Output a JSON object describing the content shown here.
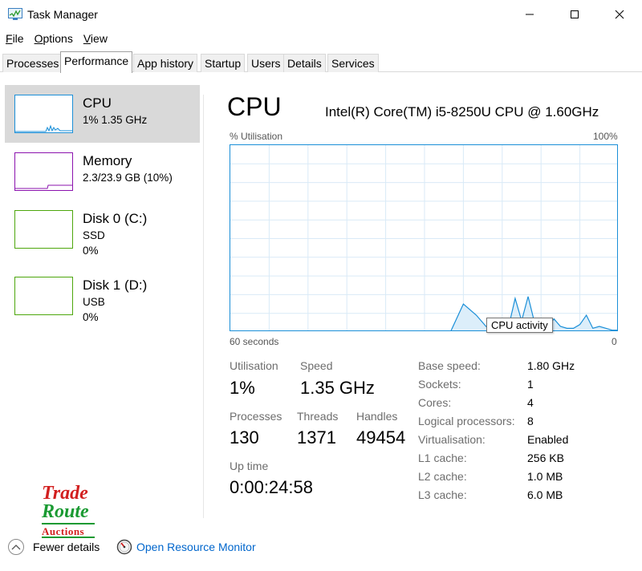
{
  "window": {
    "title": "Task Manager",
    "icon": "task-manager-icon",
    "controls": [
      "minimize-icon",
      "maximize-icon",
      "close-icon"
    ]
  },
  "menu": [
    {
      "label": "File",
      "accel": "F",
      "rest": "ile"
    },
    {
      "label": "Options",
      "accel": "O",
      "rest": "ptions"
    },
    {
      "label": "View",
      "accel": "V",
      "rest": "iew"
    }
  ],
  "tabs": [
    {
      "label": "Processes",
      "active": false
    },
    {
      "label": "Performance",
      "active": true
    },
    {
      "label": "App history",
      "active": false
    },
    {
      "label": "Startup",
      "active": false
    },
    {
      "label": "Users",
      "active": false
    },
    {
      "label": "Details",
      "active": false
    },
    {
      "label": "Services",
      "active": false
    }
  ],
  "resources": [
    {
      "name": "CPU",
      "line1": "1% 1.35 GHz",
      "line2": "",
      "color": "#1a8fd8",
      "selected": true
    },
    {
      "name": "Memory",
      "line1": "2.3/23.9 GB (10%)",
      "line2": "",
      "color": "#8b12ae",
      "selected": false
    },
    {
      "name": "Disk 0 (C:)",
      "line1": "SSD",
      "line2": "0%",
      "color": "#4da60c",
      "selected": false
    },
    {
      "name": "Disk 1 (D:)",
      "line1": "USB",
      "line2": "0%",
      "color": "#4da60c",
      "selected": false
    }
  ],
  "detail": {
    "title": "CPU",
    "model": "Intel(R) Core(TM) i5-8250U CPU @ 1.60GHz",
    "graph": {
      "y_label": "% Utilisation",
      "y_max_label": "100%",
      "x_left_label": "60 seconds",
      "x_right_label": "0",
      "tooltip": "CPU activity",
      "line_color": "#1a8fd8",
      "fill_color": "#dceefa",
      "grid_color": "#d9eaf7"
    },
    "stats": {
      "utilisation_label": "Utilisation",
      "utilisation": "1%",
      "speed_label": "Speed",
      "speed": "1.35 GHz",
      "processes_label": "Processes",
      "processes": "130",
      "threads_label": "Threads",
      "threads": "1371",
      "handles_label": "Handles",
      "handles": "49454",
      "uptime_label": "Up time",
      "uptime": "0:00:24:58"
    },
    "specs": [
      {
        "label": "Base speed:",
        "value": "1.80 GHz"
      },
      {
        "label": "Sockets:",
        "value": "1"
      },
      {
        "label": "Cores:",
        "value": "4"
      },
      {
        "label": "Logical processors:",
        "value": "8"
      },
      {
        "label": "Virtualisation:",
        "value": "Enabled"
      },
      {
        "label": "L1 cache:",
        "value": "256 KB"
      },
      {
        "label": "L2 cache:",
        "value": "1.0 MB"
      },
      {
        "label": "L3 cache:",
        "value": "6.0 MB"
      }
    ]
  },
  "chart_data": {
    "type": "area",
    "x": [
      60,
      58,
      56,
      54,
      52,
      50,
      48,
      46,
      44,
      42,
      40,
      38,
      36,
      34,
      32,
      30,
      28,
      26,
      24,
      22,
      20,
      18,
      17,
      16,
      15,
      14,
      13,
      12,
      11,
      10,
      9,
      8,
      7,
      6,
      5,
      4,
      3,
      2,
      1,
      0
    ],
    "values": [
      0,
      0,
      0,
      0,
      0,
      0,
      0,
      0,
      0,
      0,
      0,
      0,
      0,
      0,
      0,
      0,
      0,
      0,
      15,
      9,
      1,
      2,
      3,
      18,
      6,
      19,
      5,
      6,
      3,
      7,
      3,
      2,
      2,
      4,
      9,
      2,
      3,
      2,
      1,
      1
    ],
    "ylim": [
      0,
      100
    ],
    "xlim": [
      60,
      0
    ],
    "grid": true
  },
  "logo": {
    "line1": "Trade",
    "line2": "Route",
    "line3": "Auctions"
  },
  "footer": {
    "fewer_details": "Fewer details",
    "fewer_accel": "d",
    "open_monitor": "Open Resource Monitor"
  }
}
